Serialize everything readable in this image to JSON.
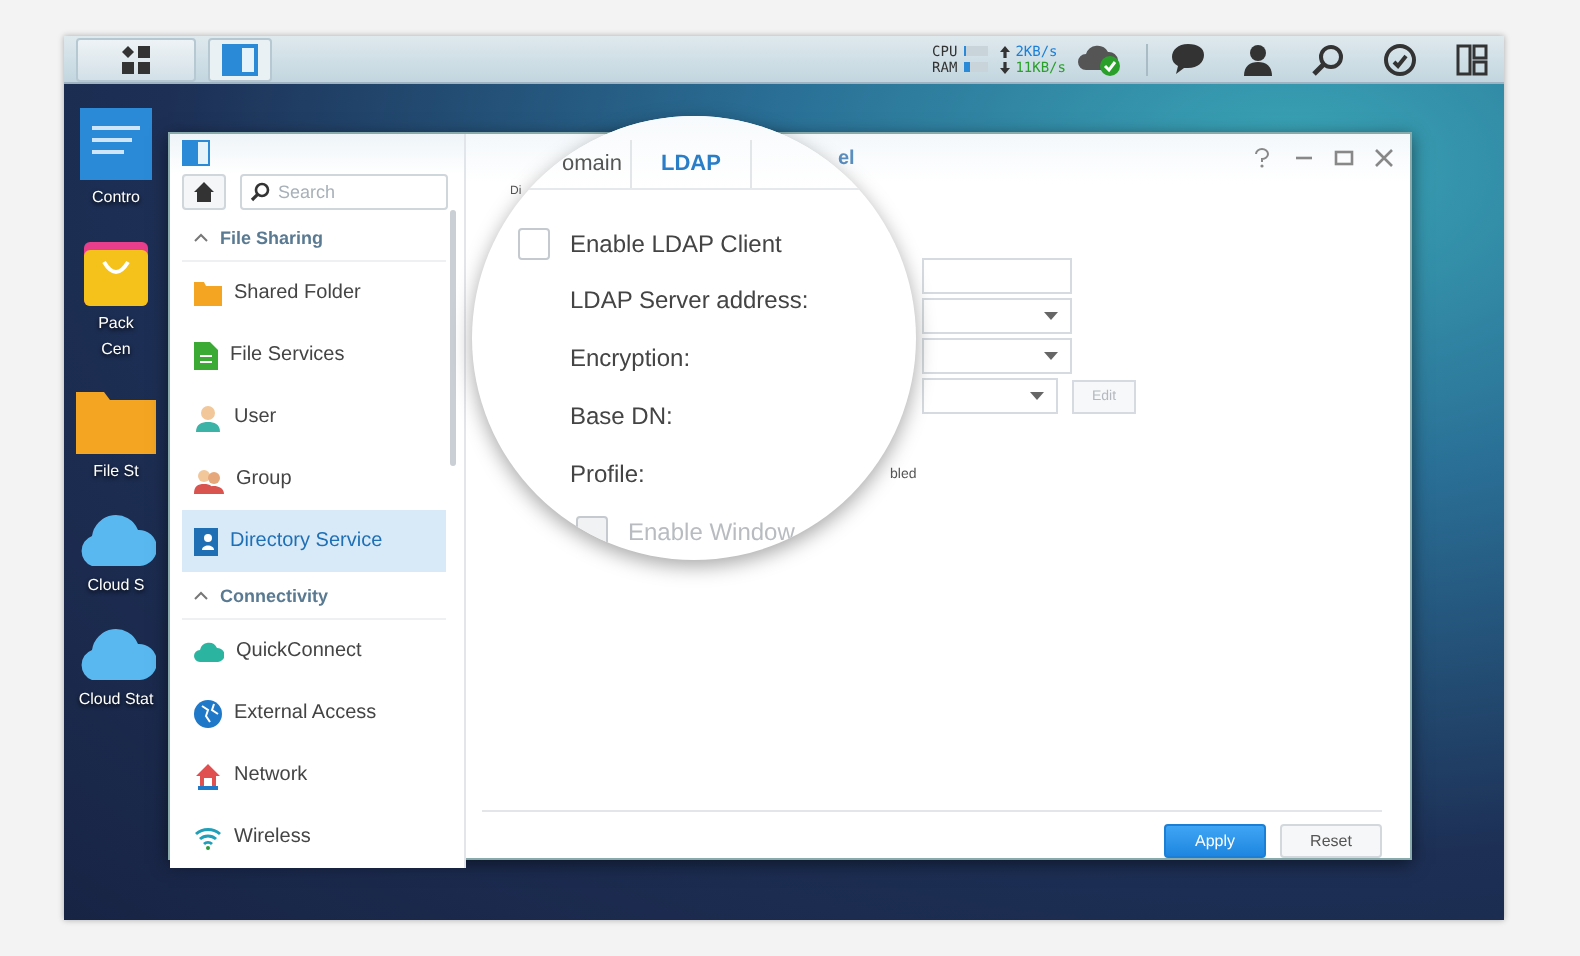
{
  "taskbar": {
    "cpu": {
      "label": "CPU",
      "level": 0.05
    },
    "ram": {
      "label": "RAM",
      "level": 0.25
    },
    "upload": "2KB/s",
    "download": "11KB/s"
  },
  "desktop_icons": [
    {
      "lines": [
        "Contro"
      ]
    },
    {
      "lines": [
        "Pack",
        "Cen"
      ]
    },
    {
      "lines": [
        "File St"
      ]
    },
    {
      "lines": [
        "Cloud S"
      ]
    },
    {
      "lines": [
        "Cloud Stat"
      ]
    }
  ],
  "sidebar": {
    "search": {
      "placeholder": "Search"
    },
    "sections": [
      {
        "title": "File Sharing",
        "expanded": true,
        "items": [
          {
            "label": "Shared Folder",
            "selected": false
          },
          {
            "label": "File Services",
            "selected": false
          },
          {
            "label": "User",
            "selected": false
          },
          {
            "label": "Group",
            "selected": false
          },
          {
            "label": "Directory Service",
            "selected": true
          }
        ]
      },
      {
        "title": "Connectivity",
        "expanded": true,
        "items": [
          {
            "label": "QuickConnect",
            "selected": false
          },
          {
            "label": "External Access",
            "selected": false
          },
          {
            "label": "Network",
            "selected": false
          },
          {
            "label": "Wireless",
            "selected": false
          }
        ]
      }
    ]
  },
  "window": {
    "visible_tab": "el",
    "sub_label": "Di",
    "fields": [
      {
        "kind": "text"
      },
      {
        "kind": "select"
      },
      {
        "kind": "select"
      },
      {
        "kind": "select",
        "button": "Edit"
      }
    ],
    "note": "bled",
    "buttons": [
      {
        "label": "Apply",
        "kind": "primary"
      },
      {
        "label": "Reset",
        "kind": "secondary"
      }
    ]
  },
  "magnifier": {
    "tabs": [
      {
        "label": "omain",
        "selected": false
      },
      {
        "label": "LDAP",
        "selected": true
      }
    ],
    "checkbox": {
      "label": "Enable LDAP Client",
      "checked": false
    },
    "labels": [
      "LDAP Server address:",
      "Encryption:",
      "Base DN:",
      "Profile:"
    ],
    "sub_checkbox": {
      "label": "Enable Window",
      "checked": false,
      "disabled": true
    }
  }
}
